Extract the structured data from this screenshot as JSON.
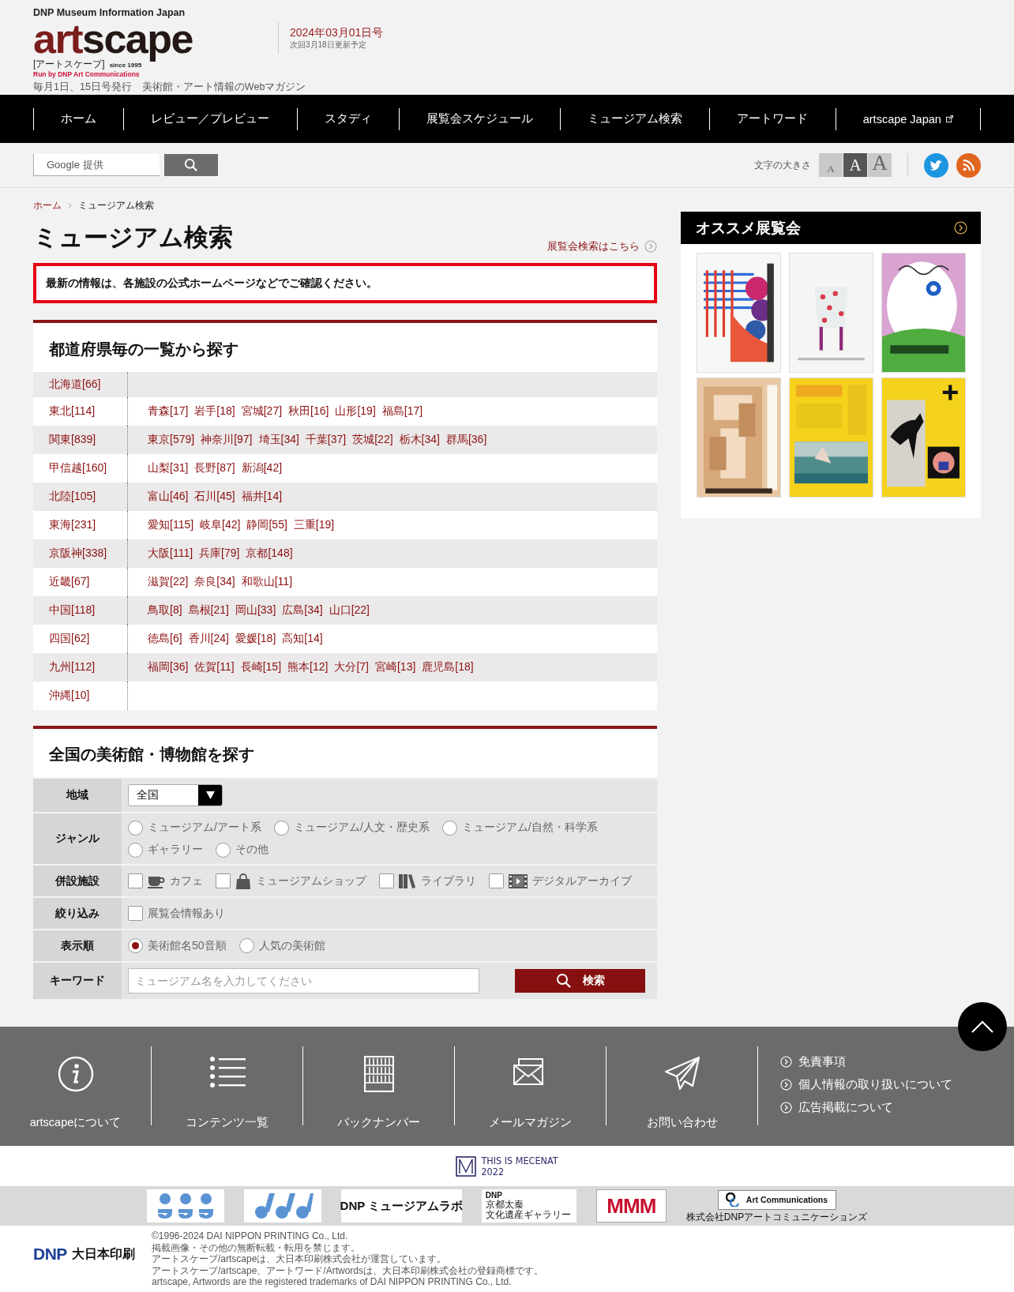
{
  "header": {
    "tagline": "DNP Museum Information Japan",
    "logo": [
      {
        "text": "art",
        "color": "#7b1d1d"
      },
      {
        "text": "scape",
        "color": "#231815"
      }
    ],
    "logo_reading": "[アートスケープ]",
    "since": "since 1995",
    "operator": "Run by DNP Art Communications",
    "issue": "2024年03月01日号",
    "next_update": "次回3月18日更新予定",
    "description": "毎月1日、15日号発行　美術館・アート情報のWebマガジン"
  },
  "nav": [
    {
      "label": "ホーム",
      "external": false
    },
    {
      "label": "レビュー／プレビュー",
      "external": false
    },
    {
      "label": "スタディ",
      "external": false
    },
    {
      "label": "展覧会スケジュール",
      "external": false
    },
    {
      "label": "ミュージアム検索",
      "external": false
    },
    {
      "label": "アートワード",
      "external": false
    },
    {
      "label": "artscape Japan",
      "external": true
    }
  ],
  "toolbar": {
    "search_placeholder": "Google 提供",
    "font_size_label": "文字の大きさ",
    "font_sizes": [
      {
        "label": "A",
        "selected": false
      },
      {
        "label": "A",
        "selected": true
      },
      {
        "label": "A",
        "selected": false
      }
    ]
  },
  "breadcrumb": [
    "ホーム",
    "ミュージアム検索"
  ],
  "page_title": "ミュージアム検索",
  "exhibition_link": "展覧会検索はこちら",
  "notice": "最新の情報は、各施設の公式ホームページなどでご確認ください。",
  "regions": {
    "heading": "都道府県毎の一覧から探す",
    "rows": [
      {
        "region": "北海道[66]"
      },
      {
        "region": "東北[114]",
        "prefectures": [
          "青森[17]",
          "岩手[18]",
          "宮城[27]",
          "秋田[16]",
          "山形[19]",
          "福島[17]"
        ]
      },
      {
        "region": "関東[839]",
        "prefectures": [
          "東京[579]",
          "神奈川[97]",
          "埼玉[34]",
          "千葉[37]",
          "茨城[22]",
          "栃木[34]",
          "群馬[36]"
        ]
      },
      {
        "region": "甲信越[160]",
        "prefectures": [
          "山梨[31]",
          "長野[87]",
          "新潟[42]"
        ]
      },
      {
        "region": "北陸[105]",
        "prefectures": [
          "富山[46]",
          "石川[45]",
          "福井[14]"
        ]
      },
      {
        "region": "東海[231]",
        "prefectures": [
          "愛知[115]",
          "岐阜[42]",
          "静岡[55]",
          "三重[19]"
        ]
      },
      {
        "region": "京阪神[338]",
        "prefectures": [
          "大阪[111]",
          "兵庫[79]",
          "京都[148]"
        ]
      },
      {
        "region": "近畿[67]",
        "prefectures": [
          "滋賀[22]",
          "奈良[34]",
          "和歌山[11]"
        ]
      },
      {
        "region": "中国[118]",
        "prefectures": [
          "鳥取[8]",
          "島根[21]",
          "岡山[33]",
          "広島[34]",
          "山口[22]"
        ]
      },
      {
        "region": "四国[62]",
        "prefectures": [
          "徳島[6]",
          "香川[24]",
          "愛媛[18]",
          "高知[14]"
        ]
      },
      {
        "region": "九州[112]",
        "prefectures": [
          "福岡[36]",
          "佐賀[11]",
          "長崎[15]",
          "熊本[12]",
          "大分[7]",
          "宮崎[13]",
          "鹿児島[18]"
        ]
      },
      {
        "region": "沖縄[10]"
      }
    ]
  },
  "search_form": {
    "heading": "全国の美術館・博物館を探す",
    "rows": [
      {
        "kind": "select",
        "label": "地域",
        "value": "全国"
      },
      {
        "kind": "radio",
        "label": "ジャンル",
        "options": [
          {
            "label": "ミュージアム/アート系",
            "selected": false
          },
          {
            "label": "ミュージアム/人文・歴史系",
            "selected": false
          },
          {
            "label": "ミュージアム/自然・科学系",
            "selected": false
          },
          {
            "label": "ギャラリー",
            "selected": false
          },
          {
            "label": "その他",
            "selected": false
          }
        ]
      },
      {
        "kind": "checkbox",
        "label": "併設施設",
        "options": [
          {
            "label": "カフェ",
            "checked": false
          },
          {
            "label": "ミュージアムショップ",
            "checked": false
          },
          {
            "label": "ライブラリ",
            "checked": false
          },
          {
            "label": "デジタルアーカイブ",
            "checked": false
          }
        ]
      },
      {
        "kind": "checkbox",
        "label": "絞り込み",
        "options": [
          {
            "label": "展覧会情報あり",
            "checked": false
          }
        ]
      },
      {
        "kind": "radio",
        "label": "表示順",
        "options": [
          {
            "label": "美術館名50音順",
            "selected": true
          },
          {
            "label": "人気の美術館",
            "selected": false
          }
        ]
      },
      {
        "kind": "keyword",
        "label": "キーワード",
        "placeholder": "ミュージアム名を入力してください",
        "button": "検索"
      }
    ]
  },
  "sidebar": {
    "title": "オススメ展覧会"
  },
  "footer": {
    "links": [
      "artscapeについて",
      "コンテンツ一覧",
      "バックナンバー",
      "メールマガジン",
      "お問い合わせ"
    ],
    "side_links": [
      "免責事項",
      "個人情報の取り扱いについて",
      "広告掲載について"
    ],
    "mecenat": {
      "title": "THIS IS MECENAT",
      "year": "2022"
    },
    "partners": [
      {
        "kind": "gmark"
      },
      {
        "kind": "dmark"
      },
      {
        "kind": "text",
        "label": "DNP ミュージアムラボ"
      },
      {
        "kind": "stacked",
        "brand": "DNP",
        "label": "京都太秦",
        "sub": "文化遺産ギャラリー"
      },
      {
        "kind": "red",
        "label": "MMM"
      },
      {
        "kind": "ac",
        "label": "Art Communications",
        "caption": "株式会社DNPアートコミュニケーションズ"
      }
    ],
    "company": {
      "brand": "DNP",
      "name": "大日本印刷"
    },
    "legal": [
      "©1996-2024 DAI NIPPON PRINTING Co., Ltd.",
      "掲載画像・その他の無断転載・転用を禁じます。",
      "アートスケープ/artscapeは、大日本印刷株式会社が運営しています。",
      "アートスケープ/artscape、アートワード/Artwordsは、大日本印刷株式会社の登録商標です。",
      "artscape, Artwords are the registered trademarks of DAI NIPPON PRINTING Co., Ltd."
    ]
  }
}
